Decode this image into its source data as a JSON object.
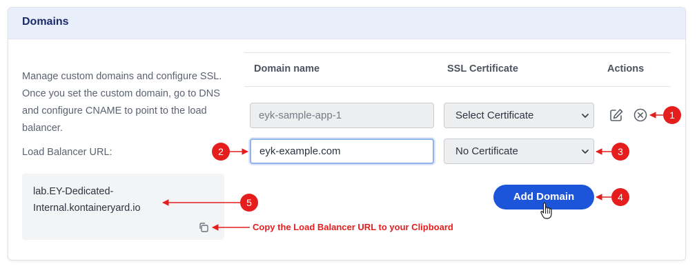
{
  "card": {
    "title": "Domains"
  },
  "description": "Manage custom domains and configure SSL. Once you set the custom domain, go to DNS and configure CNAME to point to the load balancer.",
  "load_balancer": {
    "label": "Load Balancer URL:",
    "url": "lab.EY-Dedicated-Internal.kontaineryard.io",
    "copy_icon": "copy-icon"
  },
  "table": {
    "headers": {
      "domain_name": "Domain name",
      "ssl_certificate": "SSL Certificate",
      "actions": "Actions"
    },
    "rows": [
      {
        "domain_value": "eyk-sample-app-1",
        "certificate": "Select Certificate",
        "actions": [
          "edit-icon",
          "remove-icon"
        ]
      },
      {
        "domain_value": "eyk-example.com",
        "certificate": "No Certificate"
      }
    ]
  },
  "add_domain_button": "Add Domain",
  "annotations": {
    "markers": [
      "1",
      "2",
      "3",
      "4",
      "5"
    ],
    "copy_note": "Copy the Load Balancer URL to your Clipboard",
    "color": "#e51d1d"
  },
  "colors": {
    "accent": "#1c55d9",
    "header_bg": "#e8effa",
    "title": "#1b2a6b"
  }
}
